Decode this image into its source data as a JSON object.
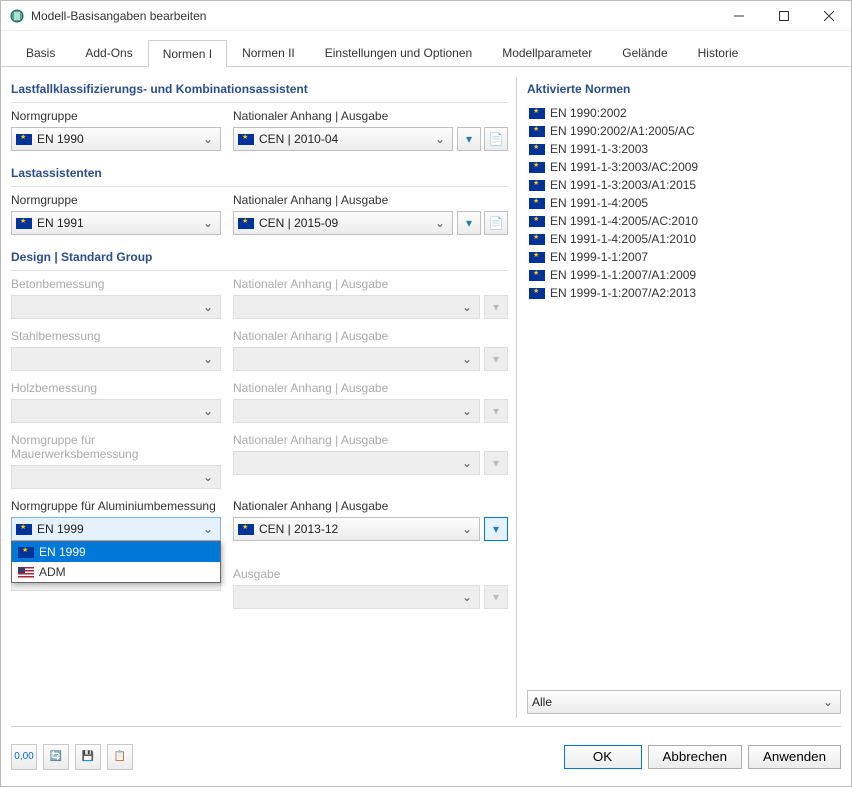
{
  "window": {
    "title": "Modell-Basisangaben bearbeiten"
  },
  "tabs": [
    "Basis",
    "Add-Ons",
    "Normen I",
    "Normen II",
    "Einstellungen und Optionen",
    "Modellparameter",
    "Gelände",
    "Historie"
  ],
  "active_tab": "Normen I",
  "sections": {
    "lastfall": {
      "title": "Lastfallklassifizierungs- und Kombinationsassistent",
      "group_label": "Normgruppe",
      "group_value": "EN 1990",
      "annex_label": "Nationaler Anhang | Ausgabe",
      "annex_value": "CEN | 2010-04"
    },
    "lastassist": {
      "title": "Lastassistenten",
      "group_label": "Normgruppe",
      "group_value": "EN 1991",
      "annex_label": "Nationaler Anhang | Ausgabe",
      "annex_value": "CEN | 2015-09"
    },
    "design": {
      "title": "Design | Standard Group",
      "rows": [
        {
          "label": "Betonbemessung",
          "annex_label": "Nationaler Anhang | Ausgabe",
          "enabled": false
        },
        {
          "label": "Stahlbemessung",
          "annex_label": "Nationaler Anhang | Ausgabe",
          "enabled": false
        },
        {
          "label": "Holzbemessung",
          "annex_label": "Nationaler Anhang | Ausgabe",
          "enabled": false
        },
        {
          "label": "Normgruppe für Mauerwerksbemessung",
          "annex_label": "Nationaler Anhang | Ausgabe",
          "enabled": false
        }
      ],
      "aluminium": {
        "label": "Normgruppe für Aluminiumbemessung",
        "value": "EN 1999",
        "annex_label": "Nationaler Anhang | Ausgabe",
        "annex_value": "CEN | 2013-12",
        "options": [
          "EN 1999",
          "ADM"
        ]
      },
      "last": {
        "annex_label": "Ausgabe",
        "enabled": false
      }
    }
  },
  "right": {
    "title": "Aktivierte Normen",
    "items": [
      "EN 1990:2002",
      "EN 1990:2002/A1:2005/AC",
      "EN 1991-1-3:2003",
      "EN 1991-1-3:2003/AC:2009",
      "EN 1991-1-3:2003/A1:2015",
      "EN 1991-1-4:2005",
      "EN 1991-1-4:2005/AC:2010",
      "EN 1991-1-4:2005/A1:2010",
      "EN 1999-1-1:2007",
      "EN 1999-1-1:2007/A1:2009",
      "EN 1999-1-1:2007/A2:2013"
    ],
    "filter_value": "Alle"
  },
  "footer": {
    "ok": "OK",
    "cancel": "Abbrechen",
    "apply": "Anwenden"
  }
}
